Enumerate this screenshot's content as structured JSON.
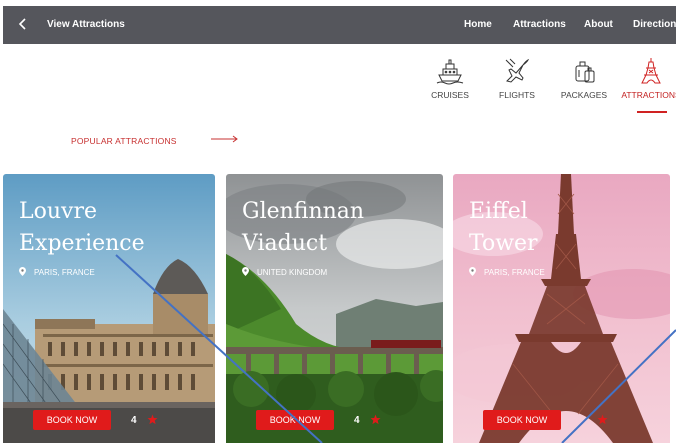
{
  "header": {
    "title": "View Attractions",
    "nav": [
      "Home",
      "Attractions",
      "About",
      "Directions"
    ]
  },
  "categories": [
    {
      "label": "CRUISES",
      "icon": "ship-icon"
    },
    {
      "label": "FLIGHTS",
      "icon": "airplane-icon"
    },
    {
      "label": "PACKAGES",
      "icon": "luggage-icon"
    },
    {
      "label": "ATTRACTIONS",
      "icon": "eiffel-tower-icon",
      "active": true
    }
  ],
  "section": {
    "label": "POPULAR ATTRACTIONS"
  },
  "cards": [
    {
      "title_line1": "Louvre",
      "title_line2": "Experience",
      "location": "PARIS, FRANCE",
      "button": "BOOK NOW",
      "rating": "4"
    },
    {
      "title_line1": "Glenfinnan",
      "title_line2": "Viaduct",
      "location": "UNITED KINGDOM",
      "button": "BOOK NOW",
      "rating": "4"
    },
    {
      "title_line1": "Eiffel",
      "title_line2": "Tower",
      "location": "PARIS, FRANCE",
      "button": "BOOK NOW",
      "rating": ""
    }
  ],
  "colors": {
    "header_bg": "#55565c",
    "accent": "#e01b1b",
    "section_label": "#c73030"
  }
}
